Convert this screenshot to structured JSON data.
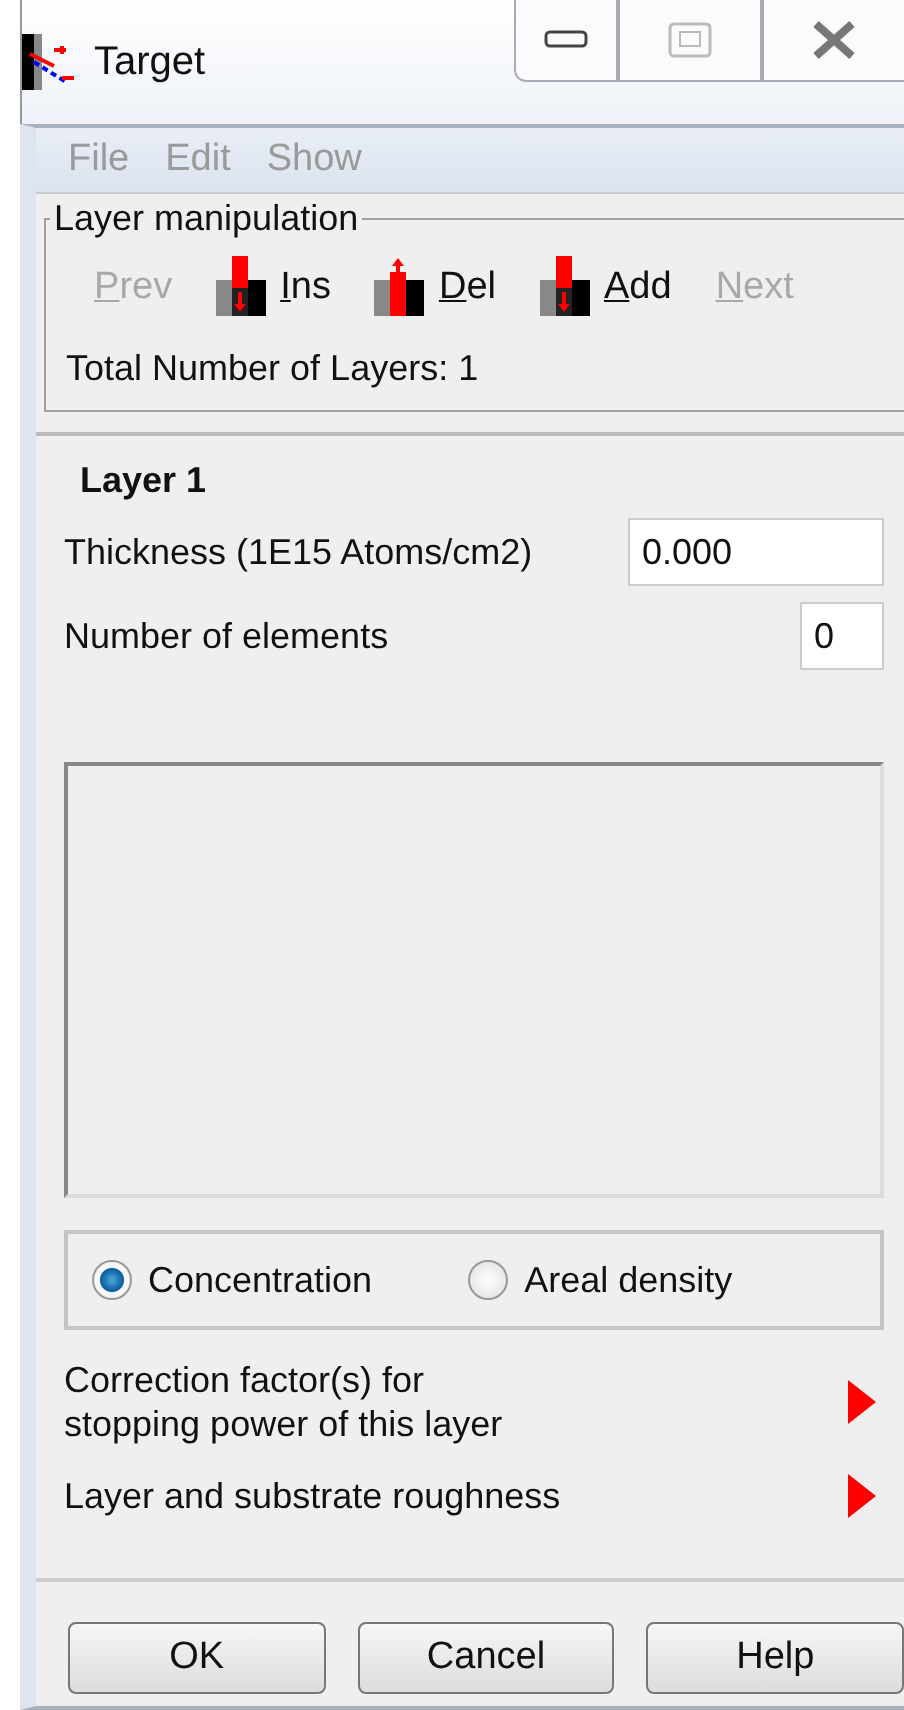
{
  "window": {
    "title": "Target"
  },
  "menu": [
    "File",
    "Edit",
    "Show"
  ],
  "layer_manipulation": {
    "title": "Layer manipulation",
    "buttons": [
      {
        "label": "Prev",
        "kind": "text",
        "disabled": true
      },
      {
        "label": "Ins",
        "kind": "ins",
        "disabled": false
      },
      {
        "label": "Del",
        "kind": "del",
        "disabled": false
      },
      {
        "label": "Add",
        "kind": "add",
        "disabled": false
      },
      {
        "label": "Next",
        "kind": "text",
        "disabled": true
      }
    ],
    "total": "Total Number of Layers: 1"
  },
  "layer": {
    "title": "Layer 1",
    "thickness_label": "Thickness (1E15 Atoms/cm2)",
    "thickness": "0.000",
    "elements_label": "Number of elements",
    "elements": "0"
  },
  "mode": [
    {
      "label": "Concentration",
      "selected": true
    },
    {
      "label": "Areal density",
      "selected": false
    }
  ],
  "expanders": [
    "Correction factor(s) for\nstopping power of this layer",
    "Layer and substrate roughness"
  ],
  "buttons": [
    "OK",
    "Cancel",
    "Help"
  ]
}
